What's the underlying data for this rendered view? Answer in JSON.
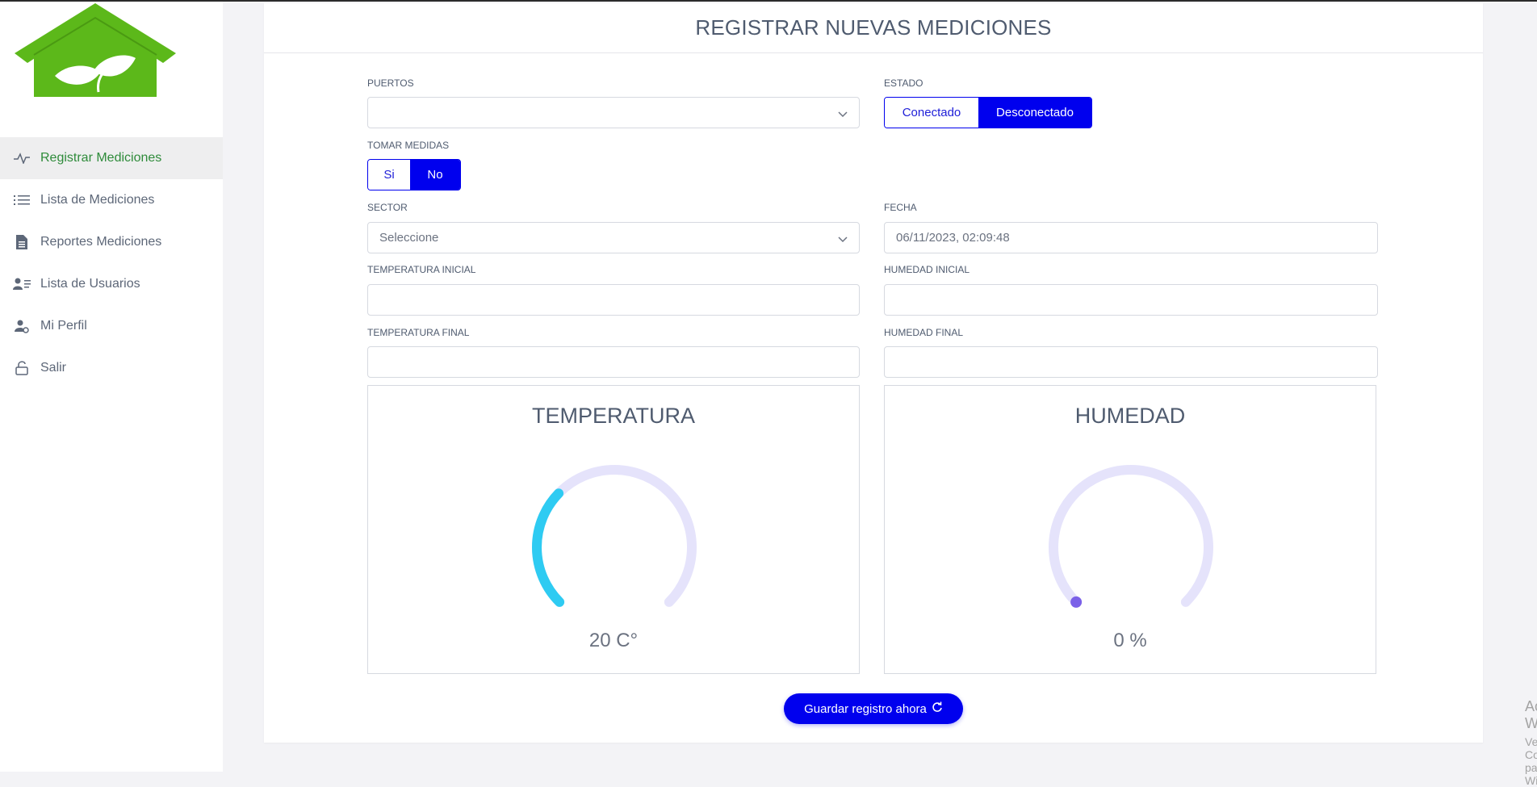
{
  "sidebar": {
    "logo": "greenhouse-leaf-logo",
    "items": [
      {
        "label": "Registrar Mediciones",
        "icon": "activity-icon",
        "active": true
      },
      {
        "label": "Lista de Mediciones",
        "icon": "list-icon",
        "active": false
      },
      {
        "label": "Reportes Mediciones",
        "icon": "report-icon",
        "active": false
      },
      {
        "label": "Lista de Usuarios",
        "icon": "users-icon",
        "active": false
      },
      {
        "label": "Mi Perfil",
        "icon": "user-gear-icon",
        "active": false
      },
      {
        "label": "Salir",
        "icon": "lock-icon",
        "active": false
      }
    ]
  },
  "main": {
    "title": "REGISTRAR NUEVAS MEDICIONES",
    "puertos": {
      "label": "PUERTOS",
      "value": ""
    },
    "estado": {
      "label": "ESTADO",
      "options": [
        "Conectado",
        "Desconectado"
      ],
      "selected": "Desconectado"
    },
    "tomar_medidas": {
      "label": "TOMAR MEDIDAS",
      "options": [
        "Si",
        "No"
      ],
      "selected": "No"
    },
    "sector": {
      "label": "SECTOR",
      "value": "Seleccione"
    },
    "fecha": {
      "label": "FECHA",
      "value": "06/11/2023, 02:09:48"
    },
    "temperatura_inicial": {
      "label": "TEMPERATURA INICIAL",
      "value": ""
    },
    "humedad_inicial": {
      "label": "HUMEDAD INICIAL",
      "value": ""
    },
    "temperatura_final": {
      "label": "TEMPERATURA FINAL",
      "value": ""
    },
    "humedad_final": {
      "label": "HUMEDAD FINAL",
      "value": ""
    },
    "gauges": {
      "temperatura": {
        "title": "TEMPERATURA",
        "value": 20,
        "display": "20 C°",
        "fraction": 0.33,
        "color": "#2ecbf2",
        "track": "#e5e3fb"
      },
      "humedad": {
        "title": "HUMEDAD",
        "value": 0,
        "display": "0 %",
        "fraction": 0.0,
        "color": "#7b61e8",
        "track": "#e5e3fb"
      }
    },
    "save_label": "Guardar registro ahora"
  },
  "watermark": {
    "line1": "Activar Windows",
    "line2": "Ve a Configuración para activar Windows."
  },
  "colors": {
    "accent": "#0000ee",
    "active_nav": "#2e8b3a",
    "logo_green": "#5cb81a"
  }
}
